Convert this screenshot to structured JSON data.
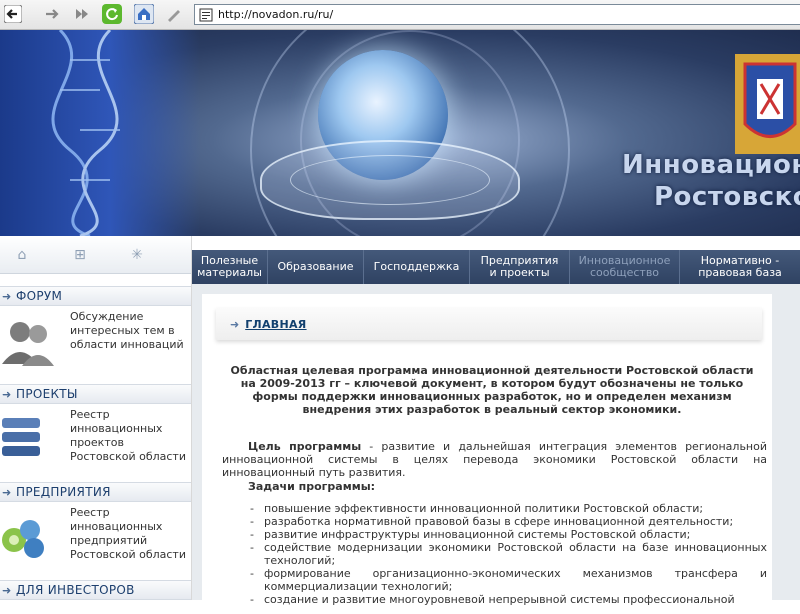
{
  "browser": {
    "url": "http://novadon.ru/ru/"
  },
  "banner": {
    "title_line1": "Инновационн",
    "title_line2": "Ростовской"
  },
  "left_icons": [
    "home-icon",
    "sitemap-icon",
    "asterisk-icon"
  ],
  "sidebar": [
    {
      "title": "ФОРУМ",
      "text": "Обсуждение интересных тем в области инноваций",
      "icon": "people-icon"
    },
    {
      "title": "ПРОЕКТЫ",
      "text": "Реестр инновационных проектов Ростовской области",
      "icon": "stack-icon"
    },
    {
      "title": "ПРЕДПРИЯТИЯ",
      "text": "Реестр инновационных предприятий Ростовской области",
      "icon": "spheres-icon"
    },
    {
      "title": "ДЛЯ ИНВЕСТОРОВ"
    }
  ],
  "nav": [
    {
      "line1": "Полезные",
      "line2": "материалы"
    },
    {
      "line1": "Образование",
      "line2": ""
    },
    {
      "line1": "Господдержка",
      "line2": ""
    },
    {
      "line1": "Предприятия",
      "line2": "и проекты"
    },
    {
      "line1": "Инновационное",
      "line2": "сообщество"
    },
    {
      "line1": "Нормативно -",
      "line2": "правовая база"
    }
  ],
  "breadcrumb": "ГЛАВНАЯ",
  "intro": "Областная целевая программа инновационной деятельности Ростовской области на 2009-2013 гг – ключевой документ, в котором будут обозначены не только формы поддержки инновационных разработок, но и определен механизм внедрения этих разработок в реальный сектор экономики.",
  "goal": {
    "label": "Цель программы",
    "text": " - развитие и дальнейшая интеграция элементов региональной инновационной системы в целях перевода экономики Ростовской области на инновационный путь развития."
  },
  "tasks_head": "Задачи программы:",
  "tasks": [
    "повышение эффективности инновационной политики Ростовской области;",
    "разработка нормативной правовой базы в сфере инновационной деятельности;",
    "развитие инфраструктуры инновационной системы Ростовской области;",
    "содействие модернизации экономики Ростовской области на базе инновационных технологий;",
    "формирование организационно-экономических механизмов трансфера и коммерциализации технологий;",
    "создание и развитие многоуровневой непрерывной системы профессиональной"
  ]
}
